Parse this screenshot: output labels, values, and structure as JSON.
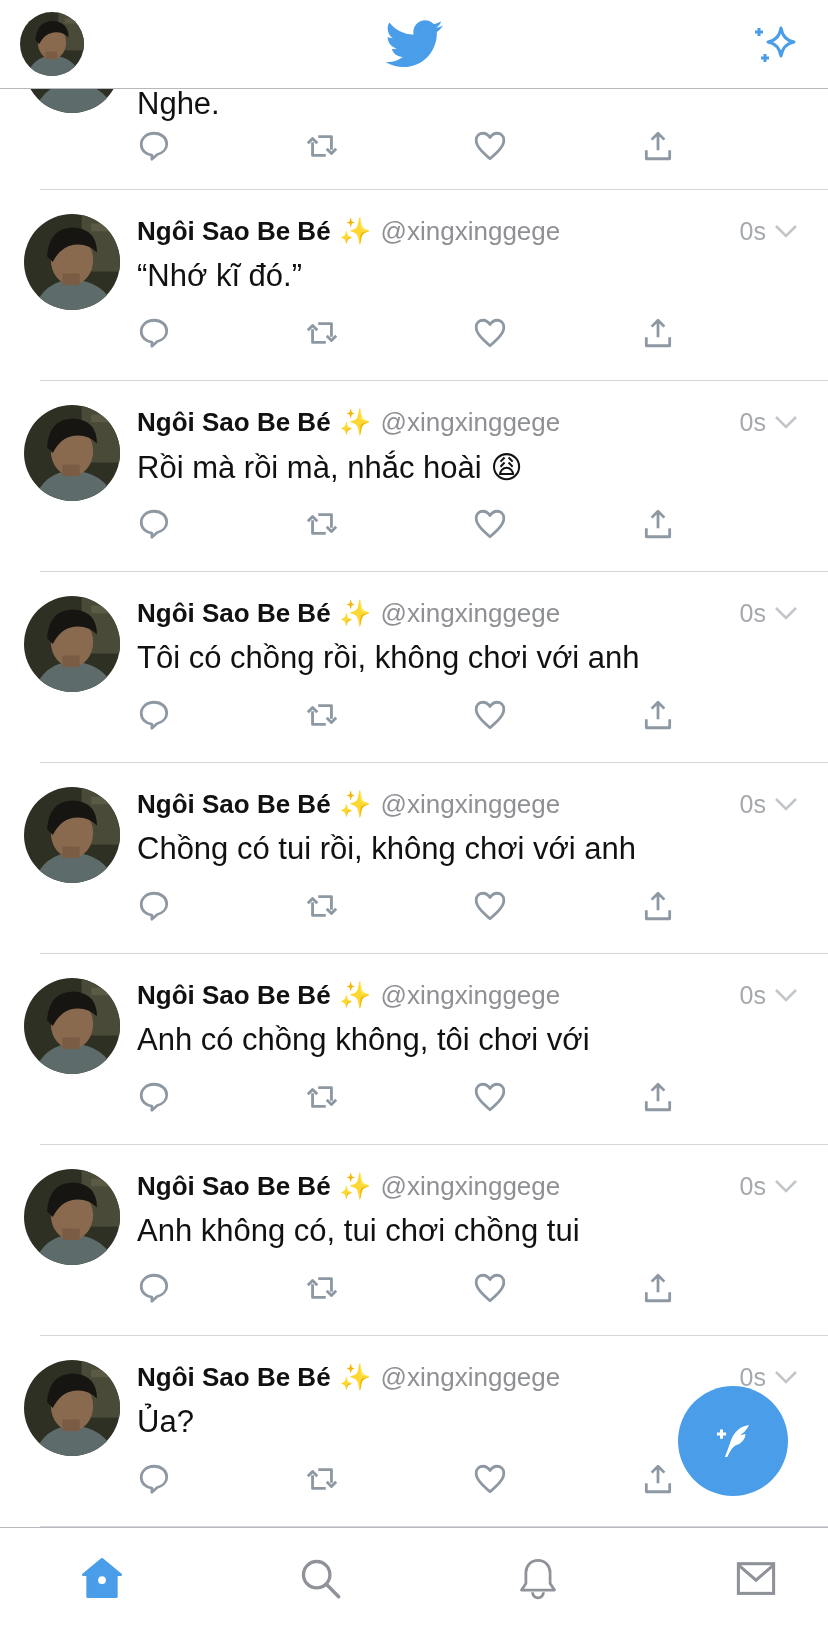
{
  "feed": [
    {
      "kind": "partial",
      "text": "Nghe."
    },
    {
      "kind": "full",
      "name": "Ngôi Sao Be Bé",
      "badge": "✨",
      "handle": "@xingxinggege",
      "time": "0s",
      "text": "“Nhớ kĩ đó.”"
    },
    {
      "kind": "full",
      "name": "Ngôi Sao Be Bé",
      "badge": "✨",
      "handle": "@xingxinggege",
      "time": "0s",
      "text": "Rồi mà rồi mà, nhắc hoài 😩"
    },
    {
      "kind": "full",
      "name": "Ngôi Sao Be Bé",
      "badge": "✨",
      "handle": "@xingxinggege",
      "time": "0s",
      "text": "Tôi có chồng rồi, không chơi với anh"
    },
    {
      "kind": "full",
      "name": "Ngôi Sao Be Bé",
      "badge": "✨",
      "handle": "@xingxinggege",
      "time": "0s",
      "text": "Chồng có tui rồi, không chơi với anh"
    },
    {
      "kind": "full",
      "name": "Ngôi Sao Be Bé",
      "badge": "✨",
      "handle": "@xingxinggege",
      "time": "0s",
      "text": "Anh có chồng không, tôi chơi với"
    },
    {
      "kind": "full",
      "name": "Ngôi Sao Be Bé",
      "badge": "✨",
      "handle": "@xingxinggege",
      "time": "0s",
      "text": "Anh không có, tui chơi chồng tui"
    },
    {
      "kind": "full",
      "name": "Ngôi Sao Be Bé",
      "badge": "✨",
      "handle": "@xingxinggege",
      "time": "0s",
      "text": "Ủa?"
    }
  ],
  "tabs": [
    {
      "kind": "home",
      "selected": true
    },
    {
      "kind": "search",
      "selected": false
    },
    {
      "kind": "notifications",
      "selected": false
    },
    {
      "kind": "messages",
      "selected": false
    }
  ]
}
